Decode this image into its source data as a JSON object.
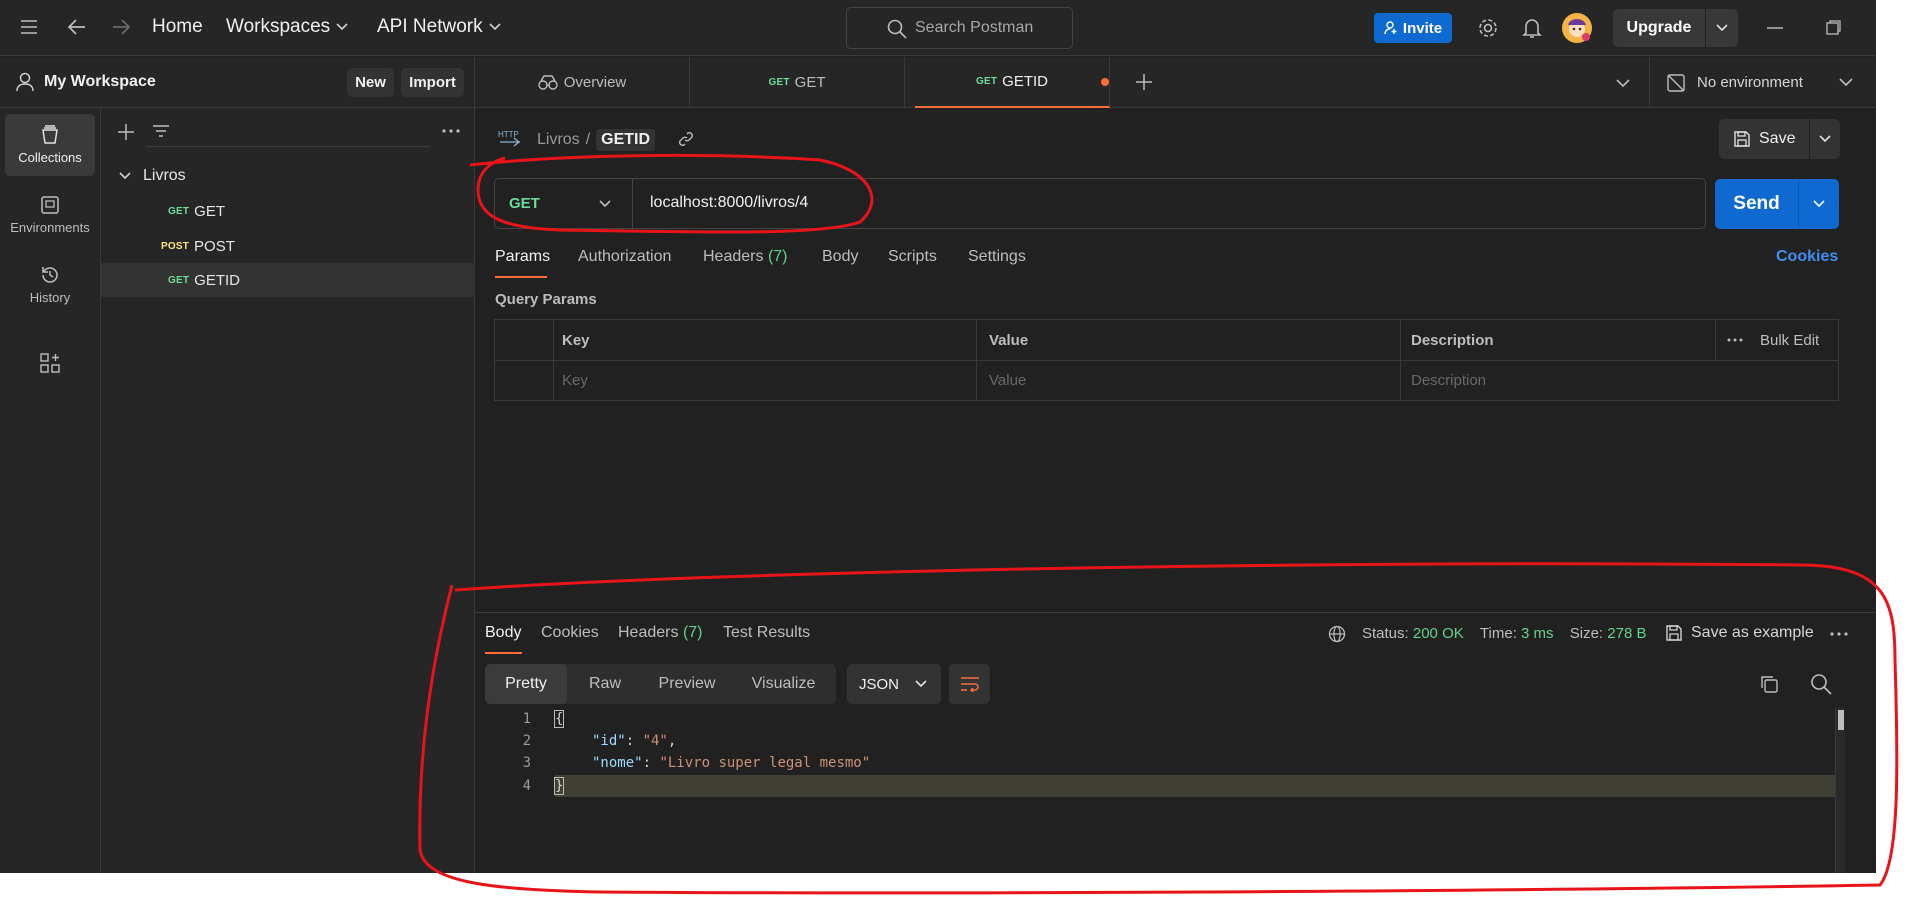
{
  "topbar": {
    "home": "Home",
    "workspaces": "Workspaces",
    "api_network": "API Network",
    "search_placeholder": "Search Postman",
    "invite": "Invite",
    "upgrade": "Upgrade"
  },
  "rail": {
    "items": [
      {
        "label": "Collections",
        "icon": "collections-icon",
        "active": true
      },
      {
        "label": "Environments",
        "icon": "environments-icon",
        "active": false
      },
      {
        "label": "History",
        "icon": "history-icon",
        "active": false
      }
    ]
  },
  "sidebar": {
    "workspace_name": "My Workspace",
    "new_button": "New",
    "import_button": "Import",
    "collection": {
      "name": "Livros",
      "requests": [
        {
          "method": "GET",
          "name": "GET",
          "selected": false
        },
        {
          "method": "POST",
          "name": "POST",
          "selected": false
        },
        {
          "method": "GET",
          "name": "GETID",
          "selected": true
        }
      ]
    }
  },
  "tabs": {
    "items": [
      {
        "label": "Overview",
        "method": ""
      },
      {
        "label": "GET",
        "method": "GET"
      },
      {
        "label": "GETID",
        "method": "GET",
        "active": true,
        "unsaved": true
      }
    ],
    "environment": "No environment"
  },
  "request": {
    "breadcrumb_collection": "Livros",
    "breadcrumb_separator": "/",
    "breadcrumb_request": "GETID",
    "http_badge": "HTTP",
    "save": "Save",
    "method": "GET",
    "url": "localhost:8000/livros/4",
    "send": "Send",
    "subtabs": [
      "Params",
      "Authorization",
      "Headers",
      "Body",
      "Scripts",
      "Settings"
    ],
    "headers_count": "(7)",
    "cookies": "Cookies",
    "query_params_title": "Query Params",
    "table": {
      "headers": [
        "Key",
        "Value",
        "Description"
      ],
      "bulk_edit": "Bulk Edit",
      "placeholders": [
        "Key",
        "Value",
        "Description"
      ]
    }
  },
  "response": {
    "tabs": [
      "Body",
      "Cookies",
      "Headers",
      "Test Results"
    ],
    "headers_count": "(7)",
    "status_label": "Status:",
    "status_value": "200 OK",
    "time_label": "Time:",
    "time_value": "3 ms",
    "size_label": "Size:",
    "size_value": "278 B",
    "save_example": "Save as example",
    "formats": [
      "Pretty",
      "Raw",
      "Preview",
      "Visualize"
    ],
    "language": "JSON",
    "lines": [
      {
        "n": "1",
        "open": "{"
      },
      {
        "n": "2",
        "key": "\"id\"",
        "value": "\"4\"",
        "trail": ","
      },
      {
        "n": "3",
        "key": "\"nome\"",
        "value": "\"Livro super legal mesmo\"",
        "trail": ""
      },
      {
        "n": "4",
        "close": "}"
      }
    ]
  },
  "colors": {
    "accent_blue": "#0e6ad1",
    "get_green": "#6bdd9a",
    "post_yellow": "#ffe47e",
    "status_green": "#5fd38d",
    "unsaved_dot": "#ff6c37",
    "annotation_red": "#e8141a"
  }
}
